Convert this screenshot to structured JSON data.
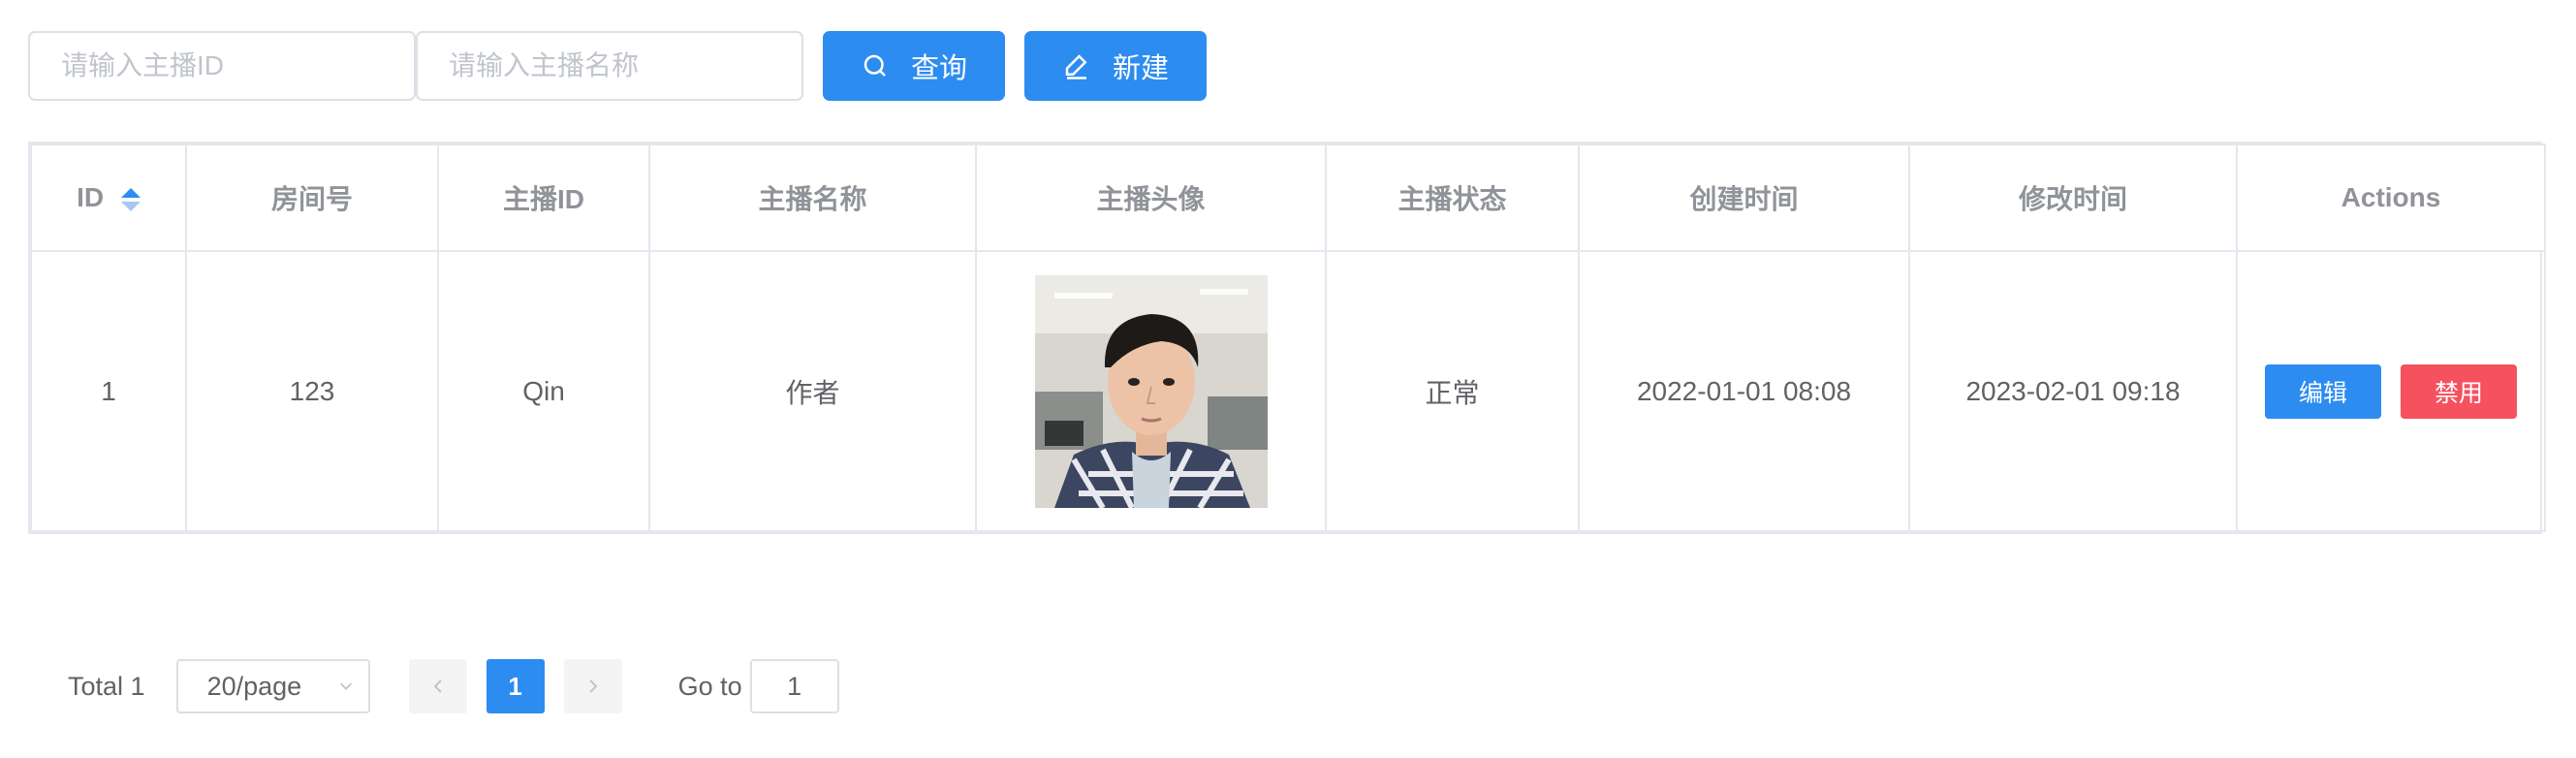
{
  "toolbar": {
    "anchor_id_placeholder": "请输入主播ID",
    "anchor_name_placeholder": "请输入主播名称",
    "query_label": "查询",
    "create_label": "新建"
  },
  "table": {
    "columns": [
      "ID",
      "房间号",
      "主播ID",
      "主播名称",
      "主播头像",
      "主播状态",
      "创建时间",
      "修改时间",
      "Actions"
    ],
    "rows": [
      {
        "id": "1",
        "room_no": "123",
        "anchor_id": "Qin",
        "anchor_name": "作者",
        "avatar": "anchor-photo",
        "status": "正常",
        "created_at": "2022-01-01 08:08",
        "updated_at": "2023-02-01 09:18",
        "edit_label": "编辑",
        "disable_label": "禁用"
      }
    ]
  },
  "pagination": {
    "total": "Total 1",
    "page_size": "20/page",
    "current_page": "1",
    "goto_label": "Go to",
    "goto_value": "1"
  },
  "colors": {
    "primary": "#2d8cf0",
    "danger": "#f5515f",
    "border": "#e4e7ed"
  },
  "icons": [
    "search-icon",
    "edit-icon",
    "sort-caret-icon",
    "chevron-down-icon",
    "chevron-left-icon",
    "chevron-right-icon"
  ]
}
